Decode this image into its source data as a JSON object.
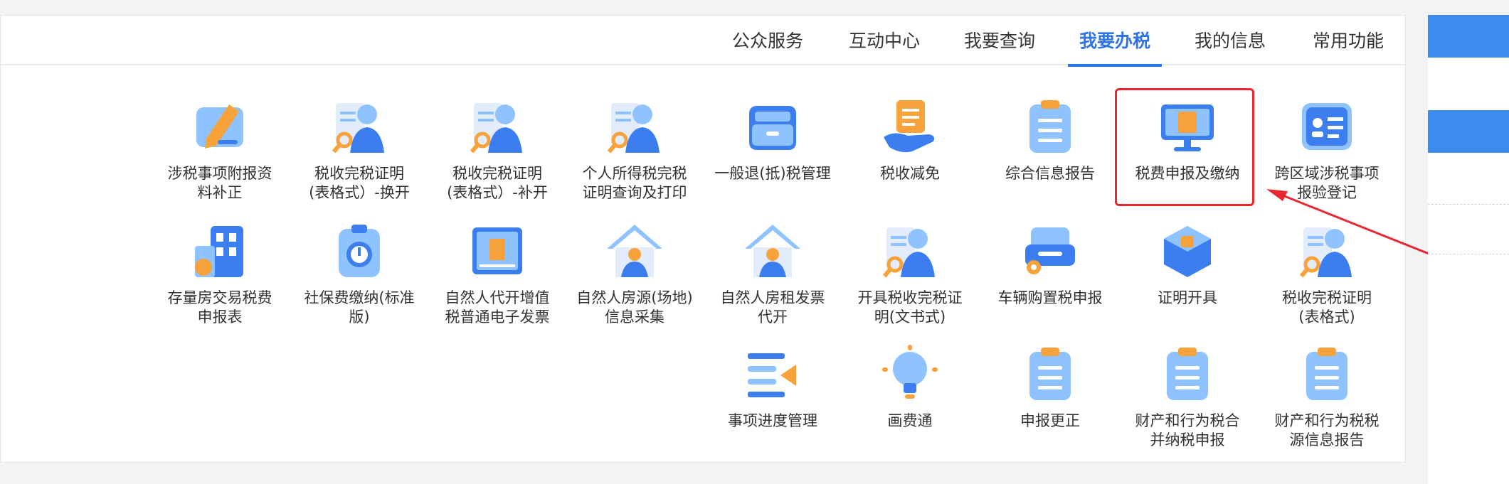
{
  "tabs": [
    {
      "label": "常用功能",
      "active": false
    },
    {
      "label": "我的信息",
      "active": false
    },
    {
      "label": "我要办税",
      "active": true
    },
    {
      "label": "我要查询",
      "active": false
    },
    {
      "label": "互动中心",
      "active": false
    },
    {
      "label": "公众服务",
      "active": false
    }
  ],
  "items": [
    {
      "label": "跨区域涉税事项\n报验登记",
      "icon": "id-card-icon"
    },
    {
      "label": "税费申报及缴纳",
      "icon": "monitor-tax-icon",
      "highlighted": true
    },
    {
      "label": "综合信息报告",
      "icon": "clipboard-list-icon"
    },
    {
      "label": "税收减免",
      "icon": "hand-document-icon"
    },
    {
      "label": "一般退(抵)税管理",
      "icon": "folder-icon"
    },
    {
      "label": "个人所得税完税\n证明查询及打印",
      "icon": "person-certificate-icon"
    },
    {
      "label": "税收完税证明\n(表格式）-补开",
      "icon": "person-certificate-icon"
    },
    {
      "label": "税收完税证明\n(表格式）-换开",
      "icon": "person-certificate-icon"
    },
    {
      "label": "涉税事项附报资\n料补正",
      "icon": "edit-pencil-icon"
    },
    {
      "label": "税收完税证明\n(表格式)",
      "icon": "person-certificate-icon"
    },
    {
      "label": "证明开具",
      "icon": "cube-yuan-icon"
    },
    {
      "label": "车辆购置税申报",
      "icon": "vehicle-gear-icon"
    },
    {
      "label": "开具税收完税证\n明(文书式)",
      "icon": "person-certificate-icon"
    },
    {
      "label": "自然人房租发票\n代开",
      "icon": "house-person-icon"
    },
    {
      "label": "自然人房源(场地)\n信息采集",
      "icon": "house-person-icon"
    },
    {
      "label": "自然人代开增值\n税普通电子发票",
      "icon": "invoice-icon"
    },
    {
      "label": "社保费缴纳(标准\n版)",
      "icon": "clock-badge-icon"
    },
    {
      "label": "存量房交易税费\n申报表",
      "icon": "building-yuan-icon"
    },
    {
      "label": "财产和行为税税\n源信息报告",
      "icon": "clipboard-list-icon"
    },
    {
      "label": "财产和行为税合\n并纳税申报",
      "icon": "clipboard-list-icon"
    },
    {
      "label": "申报更正",
      "icon": "clipboard-list-icon"
    },
    {
      "label": "画费通",
      "icon": "lightbulb-icon"
    },
    {
      "label": "事项进度管理",
      "icon": "progress-list-icon"
    }
  ],
  "colors": {
    "accent": "#2f74e6",
    "highlight": "#e8272e",
    "icon_light": "#8fc3ff",
    "icon_dark": "#3c7ef0",
    "icon_orange": "#f7a23a"
  }
}
